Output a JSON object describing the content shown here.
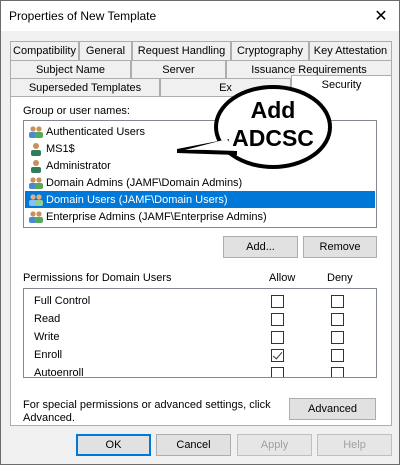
{
  "window": {
    "title": "Properties of New Template",
    "close_glyph": "✕"
  },
  "tabs_row1": [
    "Compatibility",
    "General",
    "Request Handling",
    "Cryptography",
    "Key Attestation"
  ],
  "tabs_row2": [
    "Subject Name",
    "Server",
    "Issuance Requirements"
  ],
  "tabs_row3": [
    "Superseded Templates",
    "Ex",
    "Security"
  ],
  "security": {
    "group_label": "Group or user names:",
    "users": [
      {
        "name": "Authenticated Users",
        "icon": "user-group-icon"
      },
      {
        "name": "MS1$",
        "icon": "computer-user-icon"
      },
      {
        "name": "Administrator",
        "icon": "user-icon"
      },
      {
        "name": "Domain Admins (JAMF\\Domain Admins)",
        "icon": "user-group-icon"
      },
      {
        "name": "Domain Users (JAMF\\Domain Users)",
        "icon": "user-group-icon",
        "selected": true
      },
      {
        "name": "Enterprise Admins (JAMF\\Enterprise Admins)",
        "icon": "user-group-icon"
      }
    ],
    "add_button": "Add...",
    "remove_button": "Remove",
    "permissions_label": "Permissions for Domain Users",
    "allow_header": "Allow",
    "deny_header": "Deny",
    "permissions": [
      {
        "name": "Full Control",
        "allow": false,
        "deny": false
      },
      {
        "name": "Read",
        "allow": false,
        "deny": false
      },
      {
        "name": "Write",
        "allow": false,
        "deny": false
      },
      {
        "name": "Enroll",
        "allow": true,
        "deny": false
      },
      {
        "name": "Autoenroll",
        "allow": false,
        "deny": false
      }
    ],
    "special_text_line1": "For special permissions or advanced settings, click",
    "special_text_line2": "Advanced.",
    "advanced_button": "Advanced"
  },
  "annotation": {
    "line1": "Add",
    "line2": "ADCSC"
  },
  "footer": {
    "ok": "OK",
    "cancel": "Cancel",
    "apply": "Apply",
    "help": "Help"
  },
  "colors": {
    "selection": "#0078d7",
    "window_bg": "#f0f0f0",
    "border": "#adadad"
  }
}
